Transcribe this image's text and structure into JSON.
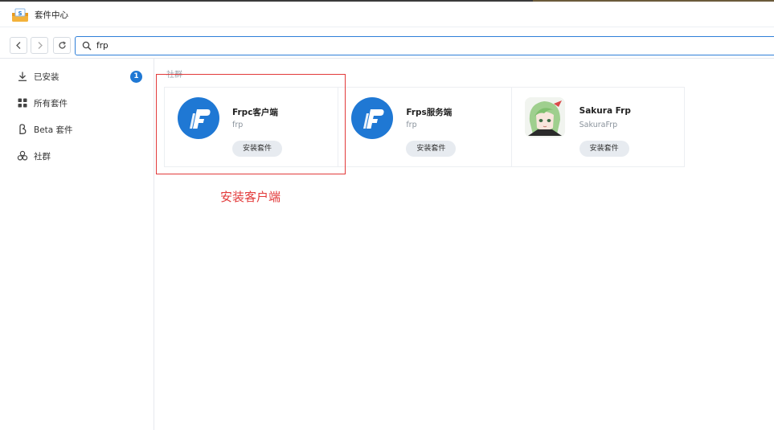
{
  "app": {
    "title": "套件中心",
    "icon": "package-center-icon"
  },
  "toolbar": {
    "back_icon": "chevron-left-icon",
    "forward_icon": "chevron-right-icon",
    "refresh_icon": "refresh-icon",
    "search_icon": "search-icon",
    "search_value": "frp"
  },
  "sidebar": {
    "items": [
      {
        "label": "已安装",
        "icon": "download-icon",
        "badge": "1"
      },
      {
        "label": "所有套件",
        "icon": "grid-icon"
      },
      {
        "label": "Beta 套件",
        "icon": "beta-icon"
      },
      {
        "label": "社群",
        "icon": "community-icon"
      }
    ]
  },
  "main": {
    "section_label": "社群",
    "packages": [
      {
        "name": "Frpc客户端",
        "author": "frp",
        "button": "安装套件",
        "logo": "frp-logo-icon"
      },
      {
        "name": "Frps服务端",
        "author": "frp",
        "button": "安装套件",
        "logo": "frp-logo-icon"
      },
      {
        "name": "Sakura Frp",
        "author": "SakuraFrp",
        "button": "安装套件",
        "logo": "anime-avatar-icon"
      }
    ]
  },
  "annotation": {
    "text": "安装客户端",
    "color": "#e23a3a"
  },
  "colors": {
    "accent": "#1f78d4",
    "highlight": "#e23a3a"
  }
}
